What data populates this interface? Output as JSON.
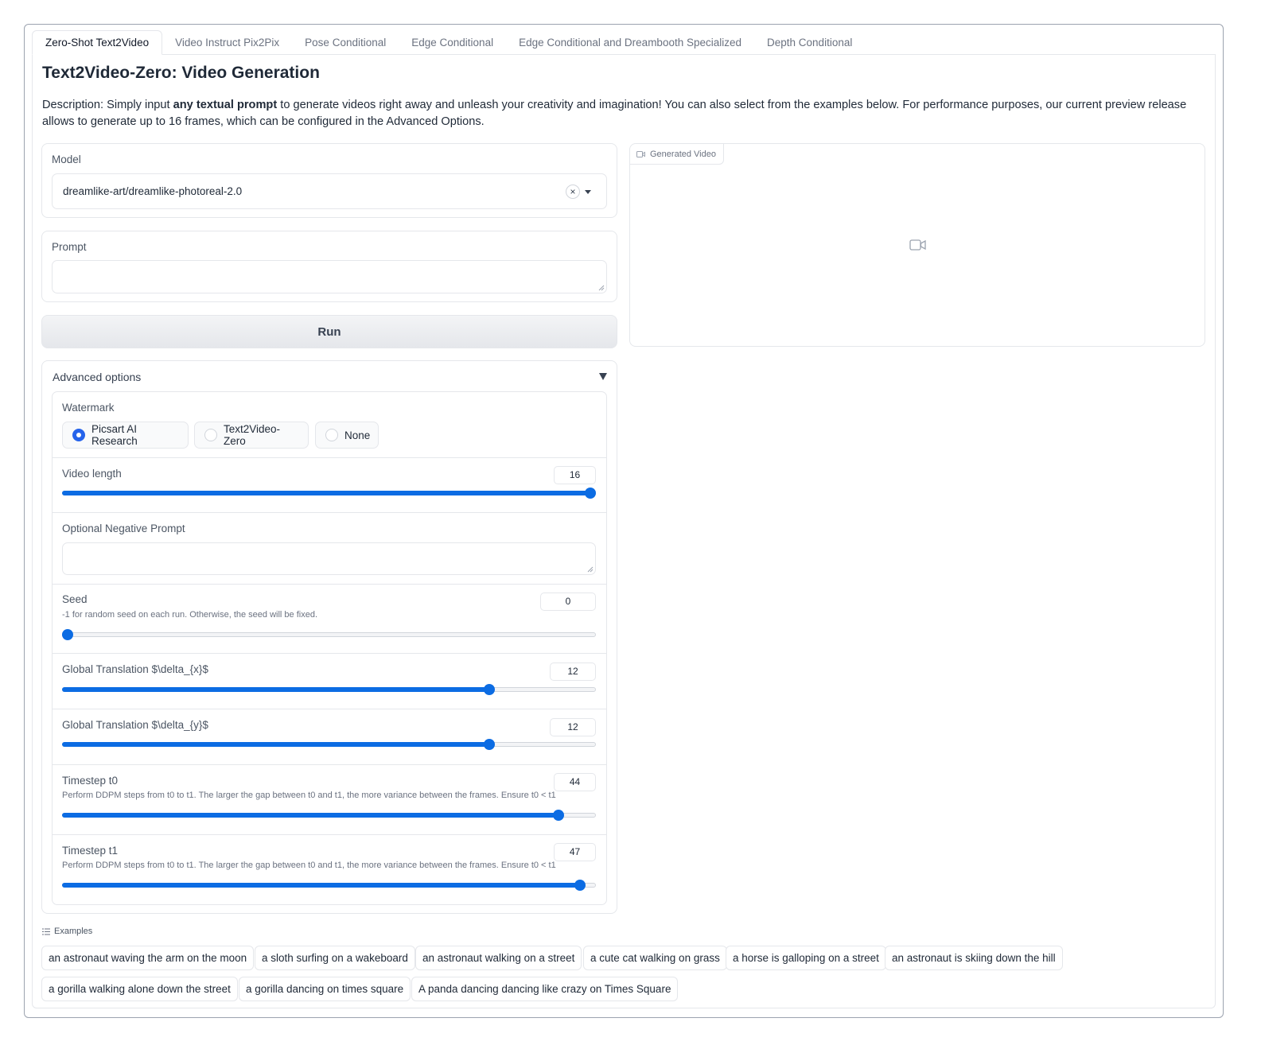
{
  "tabs": [
    {
      "label": "Zero-Shot Text2Video",
      "active": true
    },
    {
      "label": "Video Instruct Pix2Pix"
    },
    {
      "label": "Pose Conditional"
    },
    {
      "label": "Edge Conditional"
    },
    {
      "label": "Edge Conditional and Dreambooth Specialized"
    },
    {
      "label": "Depth Conditional"
    }
  ],
  "page": {
    "title": "Text2Video-Zero: Video Generation",
    "desc_pre": "Description: Simply input ",
    "desc_bold": "any textual prompt",
    "desc_post": " to generate videos right away and unleash your creativity and imagination! You can also select from the examples below. For performance purposes, our current preview release allows to generate up to 16 frames, which can be configured in the Advanced Options."
  },
  "model": {
    "label": "Model",
    "value": "dreamlike-art/dreamlike-photoreal-2.0",
    "clear_glyph": "×"
  },
  "prompt": {
    "label": "Prompt",
    "value": ""
  },
  "run_label": "Run",
  "output": {
    "label": "Generated Video",
    "icon": "video-camera-icon"
  },
  "advanced": {
    "label": "Advanced options",
    "expanded": true,
    "watermark": {
      "label": "Watermark",
      "options": [
        "Picsart AI Research",
        "Text2Video-Zero",
        "None"
      ],
      "selected": "Picsart AI Research"
    },
    "video_length": {
      "label": "Video length",
      "value": "16",
      "fraction": 1.0
    },
    "negative_prompt": {
      "label": "Optional Negative Prompt",
      "value": ""
    },
    "seed": {
      "label": "Seed",
      "info": "-1 for random seed on each run. Otherwise, the seed will be fixed.",
      "value": "0",
      "fraction": 0.0
    },
    "delta_x": {
      "label": "Global Translation $\\delta_{x}$",
      "value": "12",
      "fraction": 0.8
    },
    "delta_y": {
      "label": "Global Translation $\\delta_{y}$",
      "value": "12",
      "fraction": 0.8
    },
    "t0": {
      "label": "Timestep t0",
      "info": "Perform DDPM steps from t0 to t1. The larger the gap between t0 and t1, the more variance between the frames. Ensure t0 < t1",
      "value": "44",
      "fraction": 0.93
    },
    "t1": {
      "label": "Timestep t1",
      "info": "Perform DDPM steps from t0 to t1. The larger the gap between t0 and t1, the more variance between the frames. Ensure t0 < t1",
      "value": "47",
      "fraction": 0.97
    }
  },
  "examples": {
    "label": "Examples",
    "items": [
      "an astronaut waving the arm on the moon",
      "a sloth surfing on a wakeboard",
      "an astronaut walking on a street",
      "a cute cat walking on grass",
      "a horse is galloping on a street",
      "an astronaut is skiing down the hill",
      "a gorilla walking alone down the street",
      "a gorilla dancing on times square",
      "A panda dancing dancing like crazy on Times Square"
    ]
  },
  "colors": {
    "accent": "#0c6ce3",
    "radio_selected": "#2563eb",
    "border": "#e5e7eb"
  }
}
